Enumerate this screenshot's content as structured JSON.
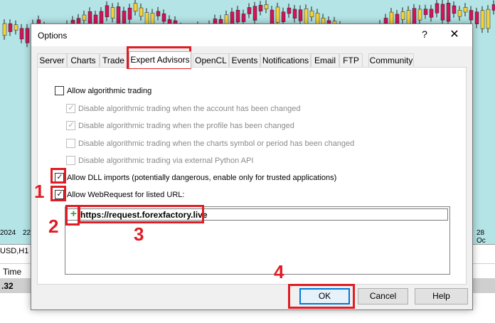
{
  "background": {
    "axis_labels": [
      "2024",
      "22",
      "28 Oc"
    ],
    "symbol": "USD,H1",
    "time_header": "Time",
    "price": ".32"
  },
  "dialog": {
    "title": "Options",
    "help": "?",
    "close": "✕",
    "tabs": [
      "Server",
      "Charts",
      "Trade",
      "Expert Advisors",
      "OpenCL",
      "Events",
      "Notifications",
      "Email",
      "FTP",
      "Community"
    ],
    "active_tab": "Expert Advisors",
    "options": [
      {
        "label": "Allow algorithmic trading",
        "checked": false,
        "disabled": false
      },
      {
        "label": "Disable algorithmic trading when the account has been changed",
        "checked": true,
        "disabled": true
      },
      {
        "label": "Disable algorithmic trading when the profile has been changed",
        "checked": true,
        "disabled": true
      },
      {
        "label": "Disable algorithmic trading when the charts symbol or period has been changed",
        "checked": false,
        "disabled": true
      },
      {
        "label": "Disable algorithmic trading via external Python API",
        "checked": false,
        "disabled": true
      },
      {
        "label": "Allow DLL imports (potentially dangerous, enable only for trusted applications)",
        "checked": true,
        "disabled": false
      },
      {
        "label": "Allow WebRequest for listed URL:",
        "checked": true,
        "disabled": false
      }
    ],
    "url_entry": "https://request.forexfactory.live",
    "buttons": {
      "ok": "OK",
      "cancel": "Cancel",
      "help": "Help"
    }
  },
  "annotations": [
    "1",
    "2",
    "3",
    "4"
  ],
  "colors": {
    "annotation": "#e01c24",
    "chart_bg": "#b4e4e6",
    "bull": "#f4d23b",
    "bear": "#d4145a",
    "plus": "#2da12d"
  }
}
